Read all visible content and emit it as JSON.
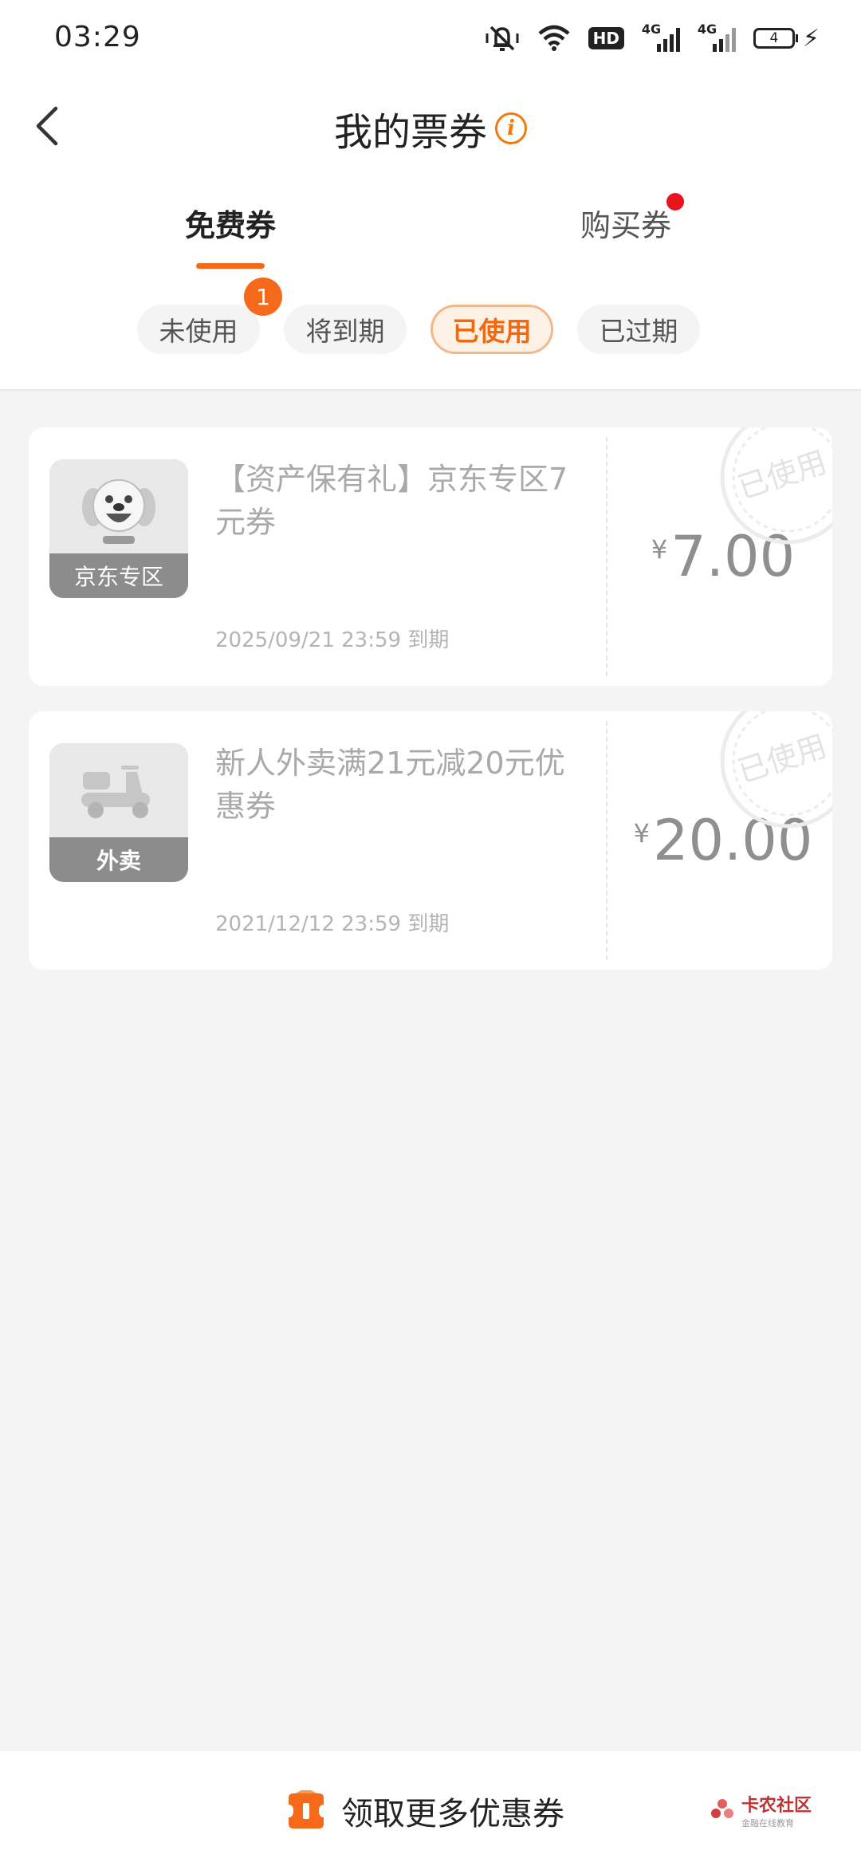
{
  "status_bar": {
    "time": "03:29",
    "hd_label": "HD",
    "signal1_label": "4G",
    "signal2_label": "4G",
    "battery": "4"
  },
  "header": {
    "title": "我的票券"
  },
  "tabs": [
    {
      "label": "免费券",
      "active": true
    },
    {
      "label": "购买券",
      "active": false
    }
  ],
  "filters": [
    {
      "label": "未使用",
      "badge": "1"
    },
    {
      "label": "将到期"
    },
    {
      "label": "已使用",
      "active": true
    },
    {
      "label": "已过期"
    }
  ],
  "coupons": [
    {
      "thumb_label": "京东专区",
      "title": "【资产保有礼】京东专区7元券",
      "expire": "2025/09/21 23:59 到期",
      "currency": "¥",
      "amount": "7.00",
      "stamp": "已使用"
    },
    {
      "thumb_label": "外卖",
      "title": "新人外卖满21元减20元优惠券",
      "expire": "2021/12/12 23:59 到期",
      "currency": "¥",
      "amount": "20.00",
      "stamp": "已使用"
    }
  ],
  "bottom": {
    "cta_label": "领取更多优惠券",
    "watermark_title": "卡农社区",
    "watermark_sub": "金融在线教育"
  },
  "colors": {
    "accent": "#f56a1a",
    "badge_red": "#e8141e",
    "used_gray": "#a9a9a9"
  }
}
